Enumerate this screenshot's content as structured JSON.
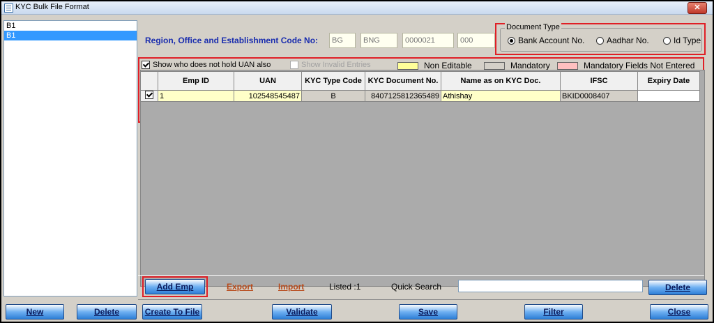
{
  "window": {
    "title": "KYC Bulk File Format",
    "close_glyph": "✕"
  },
  "left_list": {
    "items": [
      "B1",
      "B1"
    ],
    "selected_index": 1
  },
  "form": {
    "label": "Region, Office and Establishment Code No:",
    "codes": [
      "BG",
      "BNG",
      "0000021",
      "000"
    ]
  },
  "document_type": {
    "legend": "Document Type",
    "options": [
      "Bank Account No.",
      "Aadhar No.",
      "Id Type"
    ],
    "selected": "Bank Account No."
  },
  "options": {
    "show_no_uan": "Show who does not hold UAN also",
    "show_no_uan_checked": true,
    "show_invalid": "Show Invalid Entries",
    "show_invalid_checked": false
  },
  "legend": {
    "non_editable": "Non Editable",
    "non_editable_color": "#ffff99",
    "mandatory": "Mandatory",
    "mandatory_color": "#d4d0c8",
    "not_entered": "Mandatory Fields Not Entered",
    "not_entered_color": "#ffc0c0"
  },
  "table": {
    "headers": [
      "Emp ID",
      "UAN",
      "KYC Type Code",
      "KYC Document No.",
      "Name as on KYC Doc.",
      "IFSC",
      "Expiry Date"
    ],
    "rows": [
      {
        "checked": true,
        "emp_id": "1",
        "uan": "102548545487",
        "kyc_type": "B",
        "kyc_doc_no": "8407125812365489",
        "name": "Athishay",
        "ifsc": "BKID0008407",
        "expiry": ""
      }
    ]
  },
  "bottom_bar": {
    "add_emp": "Add Emp",
    "export": "Export",
    "import": "Import",
    "listed": "Listed :1",
    "quick_search_label": "Quick Search",
    "quick_search_value": "",
    "delete": "Delete"
  },
  "footer": {
    "new": "New",
    "delete": "Delete",
    "create_to_file": "Create To File",
    "validate": "Validate",
    "save": "Save",
    "filter": "Filter",
    "close": "Close"
  }
}
